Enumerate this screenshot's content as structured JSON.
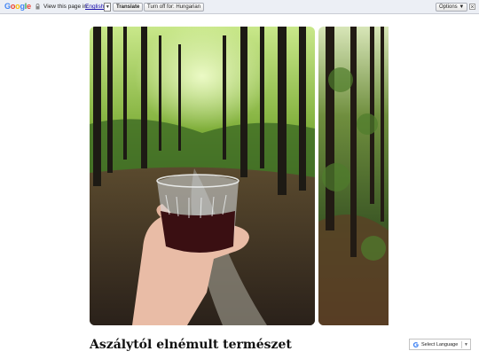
{
  "translate_bar": {
    "logo_letters": [
      "G",
      "o",
      "o",
      "g",
      "l",
      "e"
    ],
    "view_text": "View this page in:",
    "language": "English",
    "dropdown_glyph": "▼",
    "translate_label": "Translate",
    "turn_off_label": "Turn off for: Hungarian",
    "options_label": "Options ▼",
    "close_icon": "close-icon",
    "lock_icon": "lock-icon"
  },
  "gallery": {
    "main_photo": "hand holding glass of red wine in forest",
    "side_photo": "forest trees"
  },
  "post": {
    "title": "Aszálytól elnémult természet"
  },
  "language_widget": {
    "label": "Select Language",
    "arrow": "▼",
    "icon": "google-g-icon"
  }
}
